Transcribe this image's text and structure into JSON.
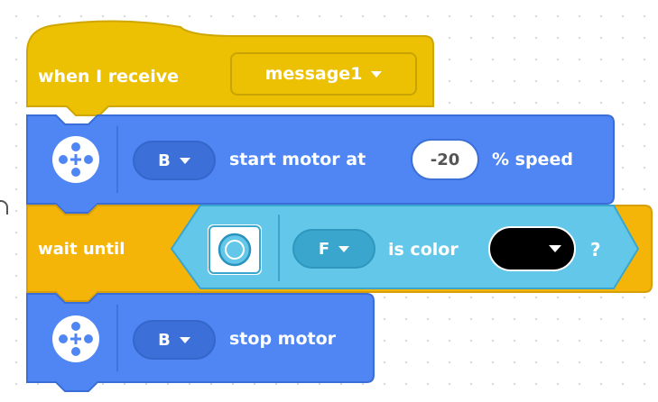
{
  "colors": {
    "event": "#ecc103",
    "event_dark": "#c9a302",
    "motor": "#4f86f4",
    "motor_dark": "#3c6fd7",
    "control": "#f4b508",
    "sensor": "#63c7ea",
    "sensor_dark": "#3aa6cd"
  },
  "blocks": {
    "hat": {
      "label": "when I receive",
      "message": "message1"
    },
    "start_motor": {
      "port": "B",
      "label": "start motor at",
      "speed": "-20",
      "unit": "% speed",
      "icon": "motor-icon"
    },
    "wait": {
      "label": "wait until",
      "sensor_port": "F",
      "condition": "is color",
      "color_value": "#000000",
      "suffix": "?",
      "icon": "color-sensor-icon"
    },
    "stop_motor": {
      "port": "B",
      "label": "stop motor",
      "icon": "motor-icon"
    }
  }
}
